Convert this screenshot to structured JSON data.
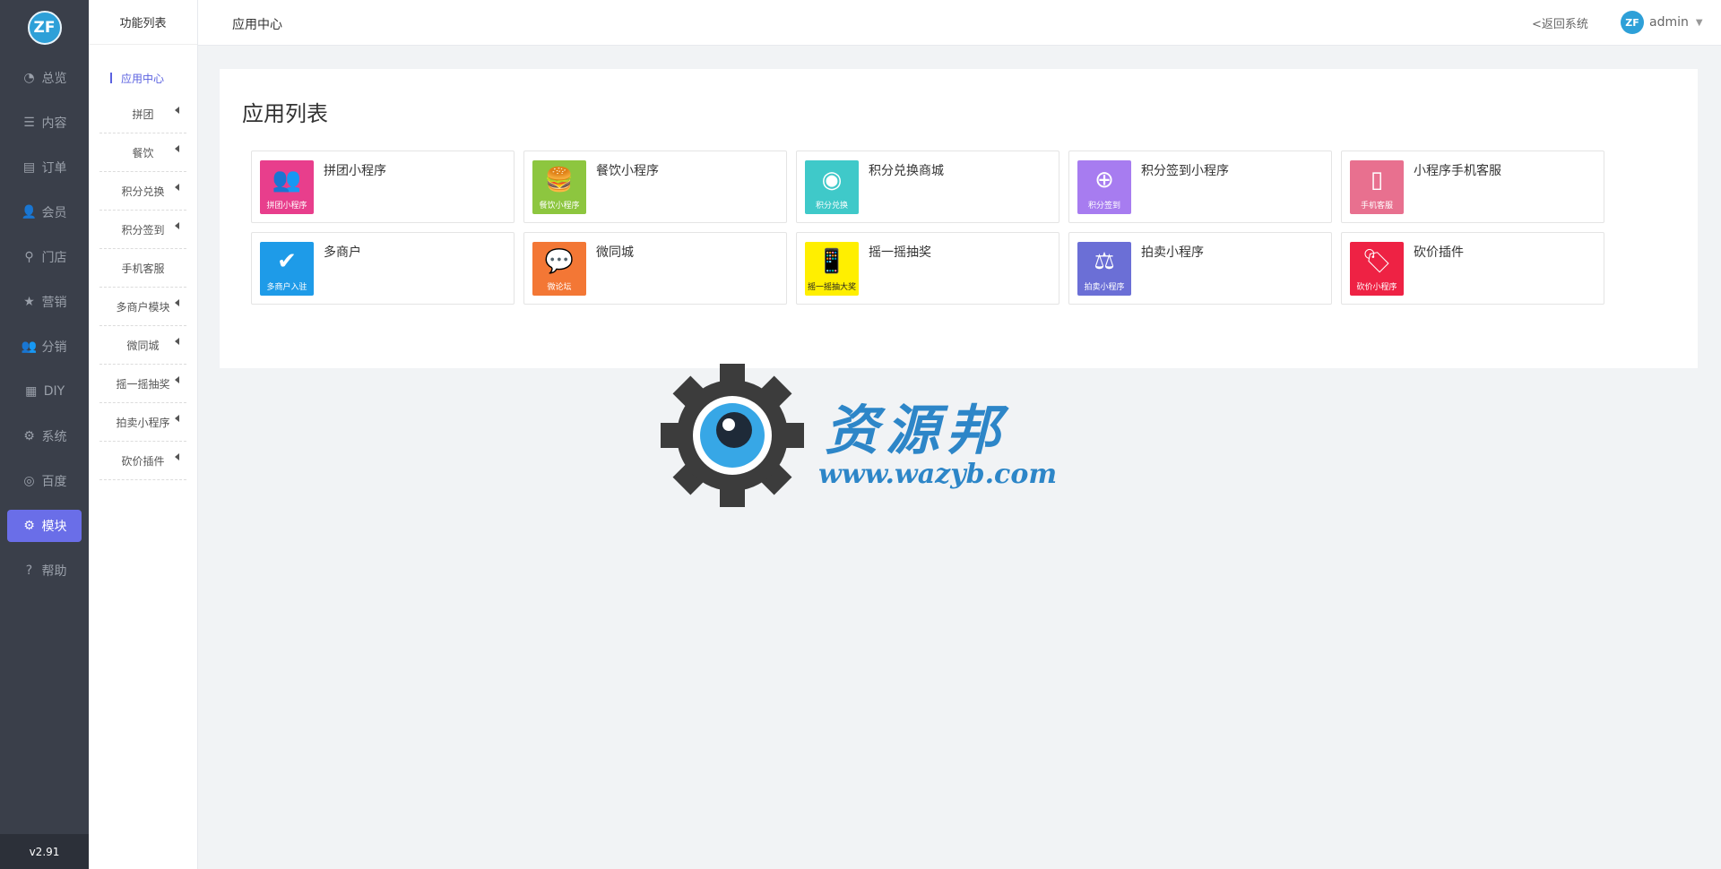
{
  "sidebar": {
    "logo_text": "ZF",
    "items": [
      {
        "label": "总览",
        "icon": "pie-chart-icon"
      },
      {
        "label": "内容",
        "icon": "list-icon"
      },
      {
        "label": "订单",
        "icon": "document-icon"
      },
      {
        "label": "会员",
        "icon": "user-icon"
      },
      {
        "label": "门店",
        "icon": "map-pin-icon"
      },
      {
        "label": "营销",
        "icon": "star-icon"
      },
      {
        "label": "分销",
        "icon": "users-icon"
      },
      {
        "label": "DIY",
        "icon": "layout-icon"
      },
      {
        "label": "系统",
        "icon": "gear-icon"
      },
      {
        "label": "百度",
        "icon": "compass-icon"
      },
      {
        "label": "模块",
        "icon": "gear-icon",
        "active": true
      },
      {
        "label": "帮助",
        "icon": "help-icon"
      }
    ],
    "version": "v2.91",
    "accent_color": "#6a6ee8"
  },
  "submenu": {
    "title": "功能列表",
    "items": [
      {
        "label": "应用中心",
        "active": true
      },
      {
        "label": "拼团",
        "caret": true
      },
      {
        "label": "餐饮",
        "caret": true
      },
      {
        "label": "积分兑换",
        "caret": true
      },
      {
        "label": "积分签到",
        "caret": true
      },
      {
        "label": "手机客服",
        "caret": false
      },
      {
        "label": "多商户模块",
        "caret": true
      },
      {
        "label": "微同城",
        "caret": true
      },
      {
        "label": "摇一摇抽奖",
        "caret": true
      },
      {
        "label": "拍卖小程序",
        "caret": true
      },
      {
        "label": "砍价插件",
        "caret": true
      }
    ]
  },
  "header": {
    "breadcrumb": "应用中心",
    "back_link": "<返回系统",
    "user": "admin",
    "avatar_text": "ZF"
  },
  "main": {
    "title": "应用列表",
    "apps": [
      {
        "name": "拼团小程序",
        "caption": "拼团小程序",
        "color": "#e83e8c",
        "icon": "group-icon",
        "glyph": "👥"
      },
      {
        "name": "餐饮小程序",
        "caption": "餐饮小程序",
        "color": "#8dc63f",
        "icon": "burger-icon",
        "glyph": "🍔"
      },
      {
        "name": "积分兑换商城",
        "caption": "积分兑换",
        "color": "#3fc9c9",
        "icon": "coins-icon",
        "glyph": "◉"
      },
      {
        "name": "积分签到小程序",
        "caption": "积分签到",
        "color": "#a77cf0",
        "icon": "coins-plus-icon",
        "glyph": "⊕"
      },
      {
        "name": "小程序手机客服",
        "caption": "手机客服",
        "color": "#e8708f",
        "icon": "phone-chat-icon",
        "glyph": "▯"
      },
      {
        "name": "多商户",
        "caption": "多商户入驻",
        "color": "#1e9be8",
        "icon": "user-shield-icon",
        "glyph": "✔"
      },
      {
        "name": "微同城",
        "caption": "微论坛",
        "color": "#f37735",
        "icon": "chat-bubbles-icon",
        "glyph": "💬"
      },
      {
        "name": "摇一摇抽奖",
        "caption": "摇一摇抽大奖",
        "color": "#ffef00",
        "icon": "shake-phone-icon",
        "glyph": "📱"
      },
      {
        "name": "拍卖小程序",
        "caption": "拍卖小程序",
        "color": "#6b6fd6",
        "icon": "gavel-icon",
        "glyph": "⚖"
      },
      {
        "name": "砍价插件",
        "caption": "砍价小程序",
        "color": "#ee2244",
        "icon": "tag-icon",
        "glyph": "🏷"
      }
    ]
  },
  "watermark": {
    "title": "资源邦",
    "url": "www.wazyb.com",
    "color": "#2d86c8"
  }
}
